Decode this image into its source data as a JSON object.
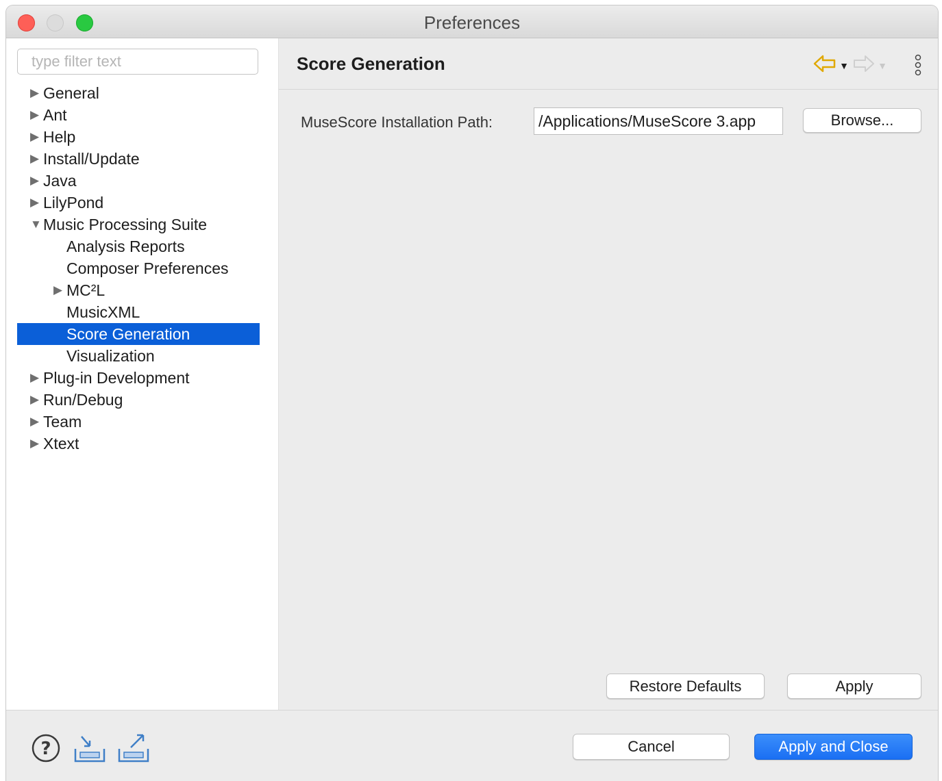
{
  "window": {
    "title": "Preferences"
  },
  "sidebar": {
    "filter_placeholder": "type filter text",
    "items": [
      {
        "label": "General",
        "arrow": "▶"
      },
      {
        "label": "Ant",
        "arrow": "▶"
      },
      {
        "label": "Help",
        "arrow": "▶"
      },
      {
        "label": "Install/Update",
        "arrow": "▶"
      },
      {
        "label": "Java",
        "arrow": "▶"
      },
      {
        "label": "LilyPond",
        "arrow": "▶"
      },
      {
        "label": "Music Processing Suite",
        "arrow": "▼"
      },
      {
        "label": "Analysis Reports"
      },
      {
        "label": "Composer Preferences"
      },
      {
        "label": "MC²L",
        "arrow": "▶"
      },
      {
        "label": "MusicXML"
      },
      {
        "label": "Score Generation"
      },
      {
        "label": "Visualization"
      },
      {
        "label": "Plug-in Development",
        "arrow": "▶"
      },
      {
        "label": "Run/Debug",
        "arrow": "▶"
      },
      {
        "label": "Team",
        "arrow": "▶"
      },
      {
        "label": "Xtext",
        "arrow": "▶"
      }
    ]
  },
  "page": {
    "title": "Score Generation",
    "nav": {
      "back_icon": "back-arrow-icon",
      "forward_icon": "forward-arrow-icon",
      "menu_icon": "view-menu-icon"
    },
    "musescore_path_label": "MuseScore Installation Path:",
    "musescore_path_value": "/Applications/MuseScore 3.app",
    "browse_label": "Browse...",
    "restore_defaults_label": "Restore Defaults",
    "apply_label": "Apply"
  },
  "footer": {
    "cancel_label": "Cancel",
    "apply_close_label": "Apply and Close",
    "icons": [
      "help-icon",
      "import-icon",
      "export-icon"
    ]
  },
  "colors": {
    "selection": "#0b5fd8",
    "primary_button": "#1a6ff3",
    "nav_back_arrow": "#f2b705"
  }
}
